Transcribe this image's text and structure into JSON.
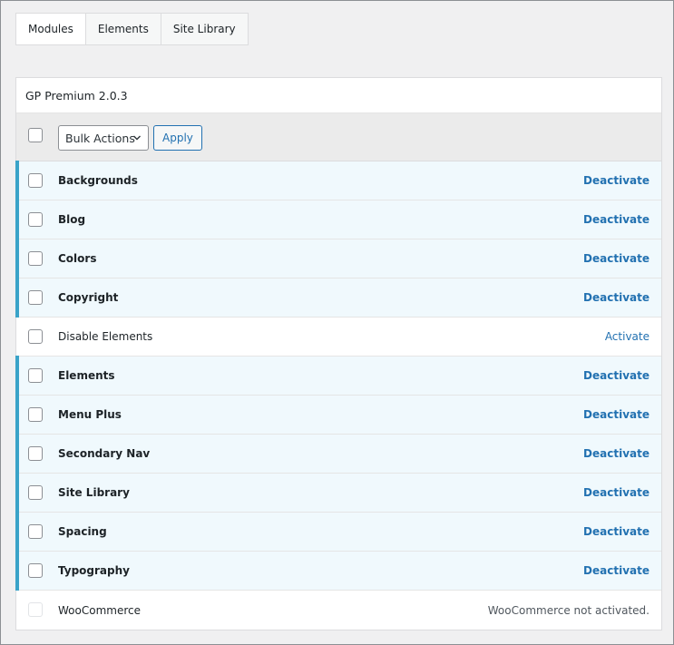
{
  "tabs": [
    {
      "label": "Modules",
      "active": true
    },
    {
      "label": "Elements",
      "active": false
    },
    {
      "label": "Site Library",
      "active": false
    }
  ],
  "panel": {
    "title": "GP Premium 2.0.3",
    "bulk_actions": {
      "selected": "Bulk Actions"
    },
    "apply_label": "Apply"
  },
  "modules": [
    {
      "name": "Backgrounds",
      "action": "Deactivate",
      "active": true
    },
    {
      "name": "Blog",
      "action": "Deactivate",
      "active": true
    },
    {
      "name": "Colors",
      "action": "Deactivate",
      "active": true
    },
    {
      "name": "Copyright",
      "action": "Deactivate",
      "active": true
    },
    {
      "name": "Disable Elements",
      "action": "Activate",
      "active": false
    },
    {
      "name": "Elements",
      "action": "Deactivate",
      "active": true
    },
    {
      "name": "Menu Plus",
      "action": "Deactivate",
      "active": true
    },
    {
      "name": "Secondary Nav",
      "action": "Deactivate",
      "active": true
    },
    {
      "name": "Site Library",
      "action": "Deactivate",
      "active": true
    },
    {
      "name": "Spacing",
      "action": "Deactivate",
      "active": true
    },
    {
      "name": "Typography",
      "action": "Deactivate",
      "active": true
    },
    {
      "name": "WooCommerce",
      "action": "WooCommerce not activated.",
      "active": false,
      "disabled": true
    }
  ],
  "colors": {
    "accent": "#2271b1",
    "active_row_bg": "#f0f9fd",
    "active_stripe": "#3aa3c8"
  }
}
